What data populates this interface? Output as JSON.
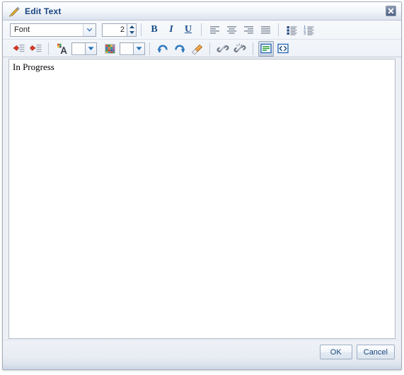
{
  "window": {
    "title": "Edit Text",
    "title_icon": "pencil-icon",
    "close_icon": "close-icon",
    "close_label": "Close"
  },
  "toolbar": {
    "font_select": {
      "value": "Font",
      "icon": "chevron-down-icon"
    },
    "font_size": {
      "value": "2",
      "up_icon": "spinner-up-icon",
      "down_icon": "spinner-down-icon"
    },
    "row1": [
      {
        "name": "bold-button",
        "label": "B",
        "style": "bold"
      },
      {
        "name": "italic-button",
        "label": "I",
        "style": "italic"
      },
      {
        "name": "underline-button",
        "label": "U",
        "style": "underline"
      },
      {
        "name": "align-left-button",
        "label": "Align Left"
      },
      {
        "name": "align-center-button",
        "label": "Align Center"
      },
      {
        "name": "align-right-button",
        "label": "Align Right"
      },
      {
        "name": "justify-button",
        "label": "Justify"
      },
      {
        "name": "bulleted-list-button",
        "label": "Bulleted List"
      },
      {
        "name": "numbered-list-button",
        "label": "Numbered List"
      }
    ],
    "row2": [
      {
        "name": "outdent-button",
        "label": "Decrease Indent"
      },
      {
        "name": "indent-button",
        "label": "Increase Indent"
      },
      {
        "name": "font-color-button",
        "label": "Font Color"
      },
      {
        "name": "background-color-button",
        "label": "Background Color"
      },
      {
        "name": "undo-button",
        "label": "Undo"
      },
      {
        "name": "redo-button",
        "label": "Redo"
      },
      {
        "name": "clear-formatting-button",
        "label": "Clear Formatting"
      },
      {
        "name": "insert-link-button",
        "label": "Insert Link"
      },
      {
        "name": "remove-link-button",
        "label": "Remove Link"
      },
      {
        "name": "wysiwyg-view-button",
        "label": "Rich Text View"
      },
      {
        "name": "source-view-button",
        "label": "Source View"
      }
    ],
    "font_color_swatch": "#fdfdfd",
    "background_color_swatch": "#fdfdfd"
  },
  "editor": {
    "content": "In Progress",
    "placeholder": ""
  },
  "footer": {
    "ok_label": "OK",
    "cancel_label": "Cancel"
  },
  "colors": {
    "title_text": "#15447e",
    "accent": "#1b4f8a",
    "border": "#a7aebb",
    "toolbar_bg": "#eef2f7"
  }
}
